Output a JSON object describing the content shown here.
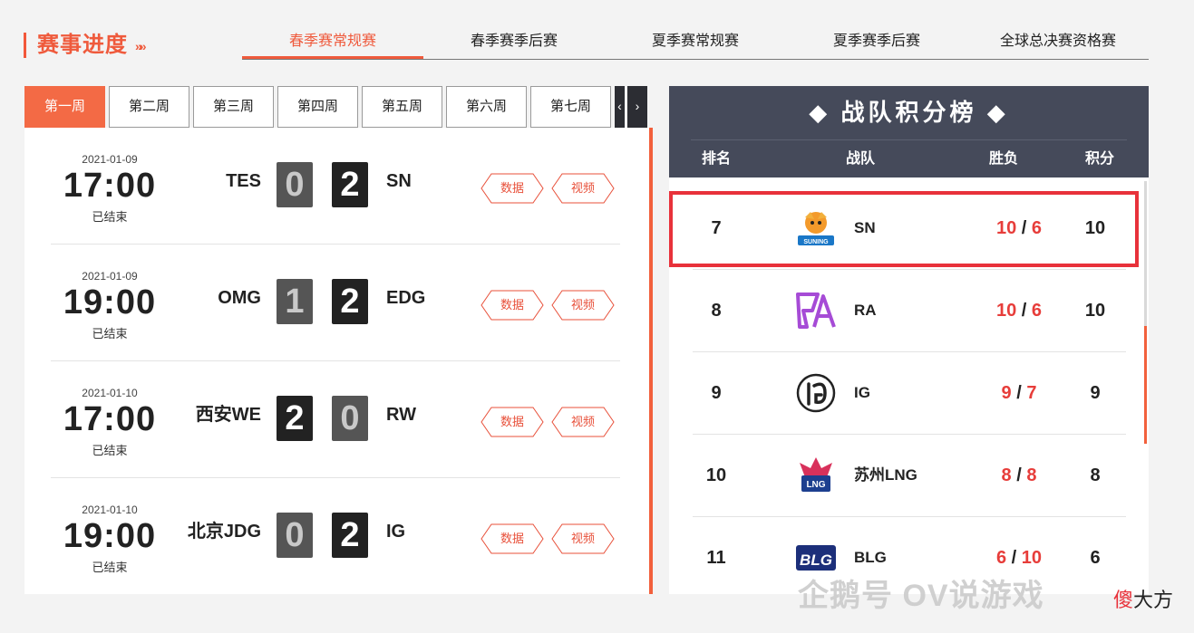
{
  "header": {
    "title": "赛事进度",
    "arrows": "»»",
    "tabs": [
      {
        "label": "春季赛常规赛",
        "active": true
      },
      {
        "label": "春季赛季后赛",
        "active": false
      },
      {
        "label": "夏季赛常规赛",
        "active": false
      },
      {
        "label": "夏季赛季后赛",
        "active": false
      },
      {
        "label": "全球总决赛资格赛",
        "active": false
      }
    ]
  },
  "weeks": {
    "items": [
      "第一周",
      "第二周",
      "第三周",
      "第四周",
      "第五周",
      "第六周",
      "第七周"
    ],
    "prev": "‹",
    "next": "›"
  },
  "matches": [
    {
      "date": "2021-01-09",
      "time": "17:00",
      "status": "已结束",
      "team_a": "TES",
      "score_a": "0",
      "team_b": "SN",
      "score_b": "2",
      "data_label": "数据",
      "video_label": "视频"
    },
    {
      "date": "2021-01-09",
      "time": "19:00",
      "status": "已结束",
      "team_a": "OMG",
      "score_a": "1",
      "team_b": "EDG",
      "score_b": "2",
      "data_label": "数据",
      "video_label": "视频"
    },
    {
      "date": "2021-01-10",
      "time": "17:00",
      "status": "已结束",
      "team_a": "西安WE",
      "score_a": "2",
      "team_b": "RW",
      "score_b": "0",
      "data_label": "数据",
      "video_label": "视频"
    },
    {
      "date": "2021-01-10",
      "time": "19:00",
      "status": "已结束",
      "team_a": "北京JDG",
      "score_a": "0",
      "team_b": "IG",
      "score_b": "2",
      "data_label": "数据",
      "video_label": "视频"
    }
  ],
  "standings": {
    "title": "◆ 战队积分榜 ◆",
    "columns": {
      "rank": "排名",
      "team": "战队",
      "record": "胜负",
      "points": "积分"
    },
    "rows": [
      {
        "rank": "7",
        "team": "SN",
        "wins": "10",
        "losses": "6",
        "points": "10",
        "logo": "sn-logo",
        "highlighted": true
      },
      {
        "rank": "8",
        "team": "RA",
        "wins": "10",
        "losses": "6",
        "points": "10",
        "logo": "ra-logo"
      },
      {
        "rank": "9",
        "team": "IG",
        "wins": "9",
        "losses": "7",
        "points": "9",
        "logo": "ig-logo"
      },
      {
        "rank": "10",
        "team": "苏州LNG",
        "wins": "8",
        "losses": "8",
        "points": "8",
        "logo": "lng-logo"
      },
      {
        "rank": "11",
        "team": "BLG",
        "wins": "6",
        "losses": "10",
        "points": "6",
        "logo": "blg-logo"
      }
    ],
    "slash": "/"
  },
  "watermark": {
    "text": "企鹅号 OV说游戏",
    "badge_red": "傻",
    "badge_rest": "大方"
  },
  "colors": {
    "accent": "#ef5a3c",
    "header_bg": "#454a5a",
    "win_red": "#e73d3a",
    "highlight_box": "#e8313a"
  }
}
